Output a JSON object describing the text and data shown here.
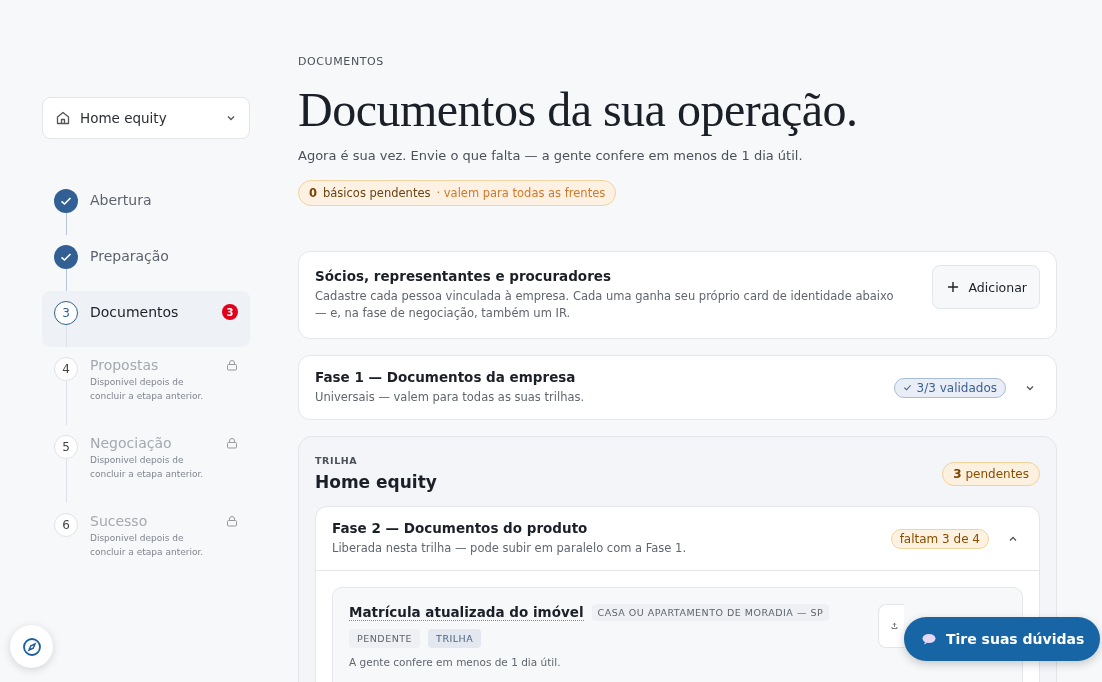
{
  "product_select": {
    "value": "Home equity"
  },
  "steps": [
    {
      "label": "Abertura",
      "done": true,
      "locked": false,
      "selected": false
    },
    {
      "label": "Preparação",
      "done": true,
      "locked": false,
      "selected": false
    },
    {
      "number": "3",
      "label": "Documentos",
      "done": false,
      "locked": false,
      "selected": true,
      "badge": "3"
    },
    {
      "number": "4",
      "label": "Propostas",
      "done": false,
      "locked": true,
      "selected": false,
      "hint": "Disponivel depois de concluir a etapa anterior."
    },
    {
      "number": "5",
      "label": "Negociação",
      "done": false,
      "locked": true,
      "selected": false,
      "hint": "Disponivel depois de concluir a etapa anterior."
    },
    {
      "number": "6",
      "label": "Sucesso",
      "done": false,
      "locked": true,
      "selected": false,
      "hint": "Disponivel depois de concluir a etapa anterior."
    }
  ],
  "eyebrow": "DOCUMENTOS",
  "title": "Documentos da sua operação.",
  "subtitle": "Agora é sua vez. Envie o que falta — a gente confere em menos de 1 dia útil.",
  "basics_pill": {
    "count": "0",
    "label": "básicos pendentes",
    "note": "· valem para todas as frentes"
  },
  "people_card": {
    "title": "Sócios, representantes e procuradores",
    "description": "Cadastre cada pessoa vinculada à empresa. Cada uma ganha seu próprio card de identidade abaixo — e, na fase de negociação, também um IR.",
    "button": "Adicionar"
  },
  "phase_1": {
    "title": "Fase 1 — Documentos da empresa",
    "subtitle": "Universais — valem para todas as suas trilhas.",
    "status": "3/3 validados",
    "validated": true,
    "expanded": false
  },
  "track": {
    "eyebrow": "TRILHA",
    "title": "Home equity",
    "pending_count": "3",
    "pending_label": "pendentes",
    "phase": {
      "title": "Fase 2 — Documentos do produto",
      "subtitle": "Liberada nesta trilha — pode subir em paralelo com a Fase 1.",
      "status": "faltam 3 de 4",
      "validated": false,
      "expanded": true,
      "documents": [
        {
          "title": "Matrícula atualizada do imóvel",
          "scope": "CASA OU APARTAMENTO DE MORADIA — SP",
          "tags": [
            "PENDENTE",
            "TRILHA"
          ],
          "note": "A gente confere em menos de 1 dia útil."
        }
      ]
    }
  },
  "chat_button": {
    "label": "Tire suas dúvidas"
  }
}
